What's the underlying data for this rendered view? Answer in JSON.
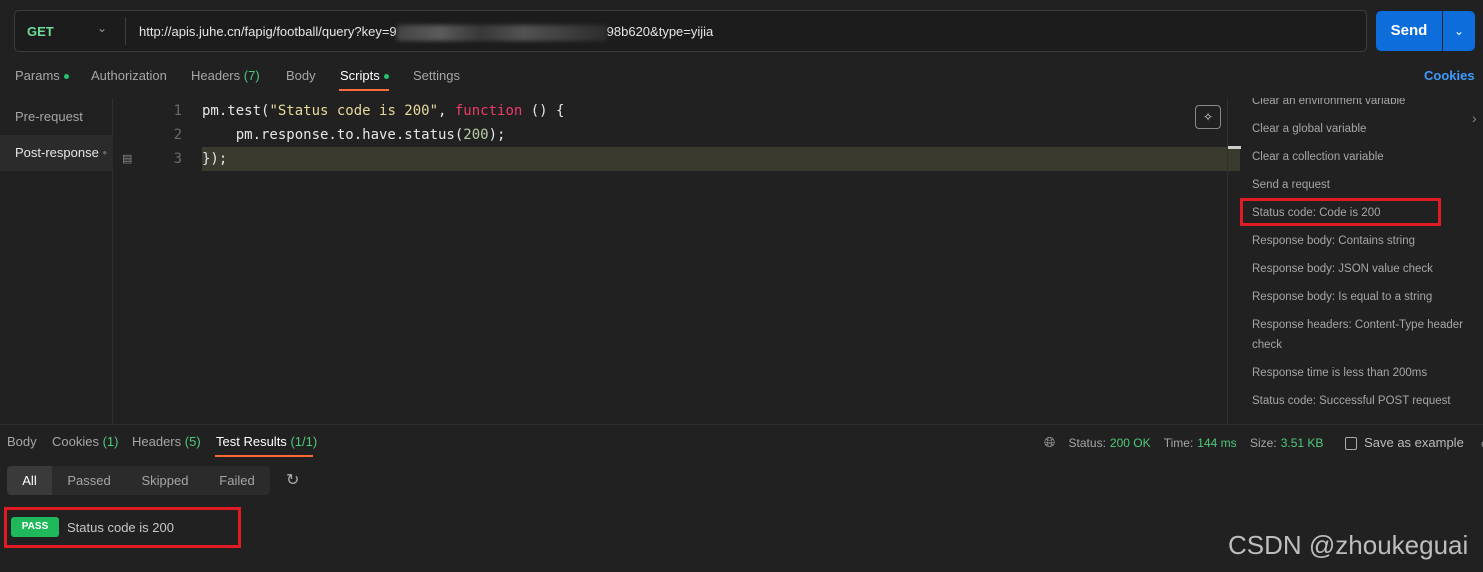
{
  "request": {
    "method": "GET",
    "url_prefix": "http://apis.juhe.cn/fapig/football/query?key=9",
    "url_suffix": "98b620&type=yijia",
    "send": "Send"
  },
  "tabs": [
    {
      "label": "Params",
      "dot": true
    },
    {
      "label": "Authorization"
    },
    {
      "label": "Headers",
      "count": "(7)"
    },
    {
      "label": "Body"
    },
    {
      "label": "Scripts",
      "dot": true,
      "active": true
    },
    {
      "label": "Settings"
    }
  ],
  "cookies_link": "Cookies",
  "script_tabs": [
    "Pre-request",
    "Post-response"
  ],
  "code": {
    "line_numbers": [
      "1",
      "2",
      "3"
    ],
    "l1a": "pm.test(",
    "l1b": "\"Status code is 200\"",
    "l1c": ", ",
    "l1d": "function",
    "l1e": " () {",
    "l2a": "    pm.response.to.have.status(",
    "l2b": "200",
    "l2c": ");",
    "l3": "});"
  },
  "snippets": [
    "Clear an environment variable",
    "Clear a global variable",
    "Clear a collection variable",
    "Send a request",
    "Status code: Code is 200",
    "Response body: Contains string",
    "Response body: JSON value check",
    "Response body: Is equal to a string",
    "Response headers: Content-Type header check",
    "Response time is less than 200ms",
    "Status code: Successful POST request"
  ],
  "response_tabs": [
    {
      "label": "Body"
    },
    {
      "label": "Cookies",
      "count": "(1)"
    },
    {
      "label": "Headers",
      "count": "(5)"
    },
    {
      "label": "Test Results",
      "count": "(1/1)",
      "active": true
    }
  ],
  "status": {
    "status_label": "Status:",
    "status": "200 OK",
    "time_label": "Time:",
    "time": "144 ms",
    "size_label": "Size:",
    "size": "3.51 KB",
    "save": "Save as example",
    "more": "ooo"
  },
  "filters": [
    "All",
    "Passed",
    "Skipped",
    "Failed"
  ],
  "result": {
    "badge": "PASS",
    "name": "Status code is 200"
  },
  "watermark": "CSDN @zhoukeguai",
  "colors": {
    "accent": "#ff6c37",
    "send": "#0d6ddb",
    "pass": "#1fb85a",
    "highlight": "#e01b24"
  }
}
